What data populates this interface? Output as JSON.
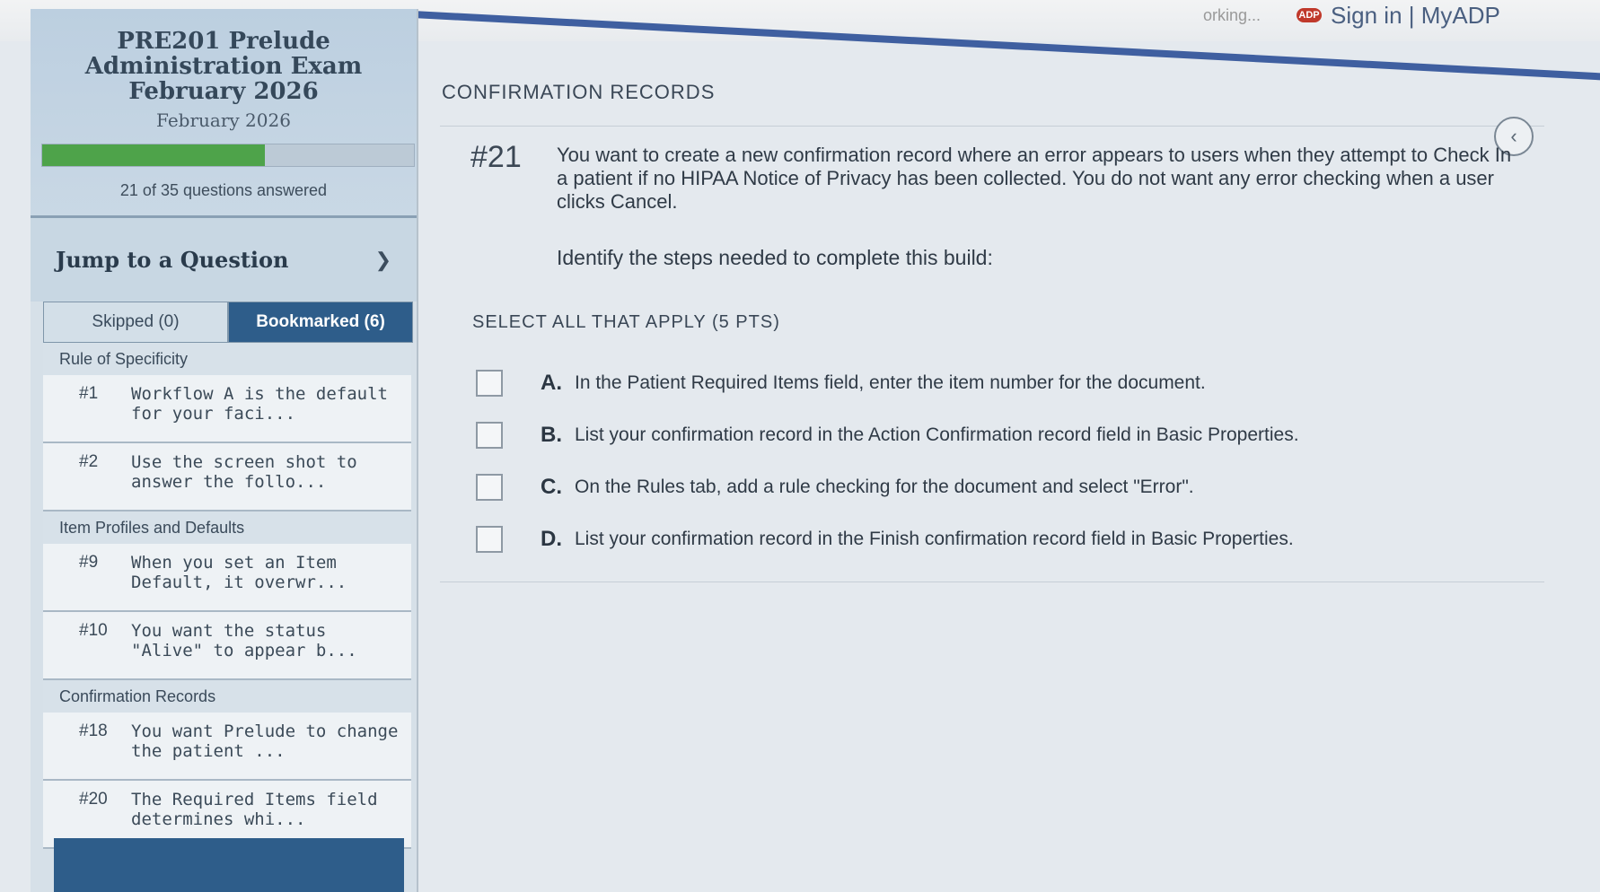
{
  "browser": {
    "tab_left_text": "orking...",
    "tab_title": "Sign in | MyADP"
  },
  "sidebar": {
    "exam_title": "PRE201 Prelude Administration Exam February 2026",
    "exam_subtitle": "February 2026",
    "progress": {
      "answered": 21,
      "total": 35,
      "fraction": 0.6,
      "text": "21 of 35 questions answered"
    },
    "jump_label": "Jump to a Question",
    "tabs": [
      {
        "label": "Skipped (0)",
        "active": false
      },
      {
        "label": "Bookmarked (6)",
        "active": true
      }
    ],
    "groups": [
      {
        "title": "Rule of Specificity",
        "items": [
          {
            "num": "#1",
            "text": "Workflow A is the default for your faci..."
          },
          {
            "num": "#2",
            "text": "Use the screen shot to answer the follo..."
          }
        ]
      },
      {
        "title": "Item Profiles and Defaults",
        "items": [
          {
            "num": "#9",
            "text": "When you set an Item Default, it overwr..."
          },
          {
            "num": "#10",
            "text": "You want the status \"Alive\" to appear b..."
          }
        ]
      },
      {
        "title": "Confirmation Records",
        "items": [
          {
            "num": "#18",
            "text": "You want Prelude to change the patient ..."
          },
          {
            "num": "#20",
            "text": "The Required Items field determines whi..."
          }
        ]
      }
    ]
  },
  "main": {
    "section_title": "CONFIRMATION RECORDS",
    "question_number": "#21",
    "question_text": "You want to create a new confirmation record where an error appears to users when they attempt to Check In a patient if no HIPAA Notice of Privacy has been collected. You do not want any error checking when a user clicks Cancel.",
    "instruction": "Identify the steps needed to complete this build:",
    "select_all": "SELECT ALL THAT APPLY (5 PTS)",
    "options": [
      {
        "letter": "A.",
        "text": "In the Patient Required Items field, enter the item number for the document.",
        "checked": false
      },
      {
        "letter": "B.",
        "text": "List your confirmation record in the Action Confirmation record field in Basic Properties.",
        "checked": false
      },
      {
        "letter": "C.",
        "text": "On the Rules tab, add a rule checking for the document and select \"Error\".",
        "checked": false
      },
      {
        "letter": "D.",
        "text": "List your confirmation record in the Finish confirmation record field in Basic Properties.",
        "checked": false
      }
    ]
  }
}
